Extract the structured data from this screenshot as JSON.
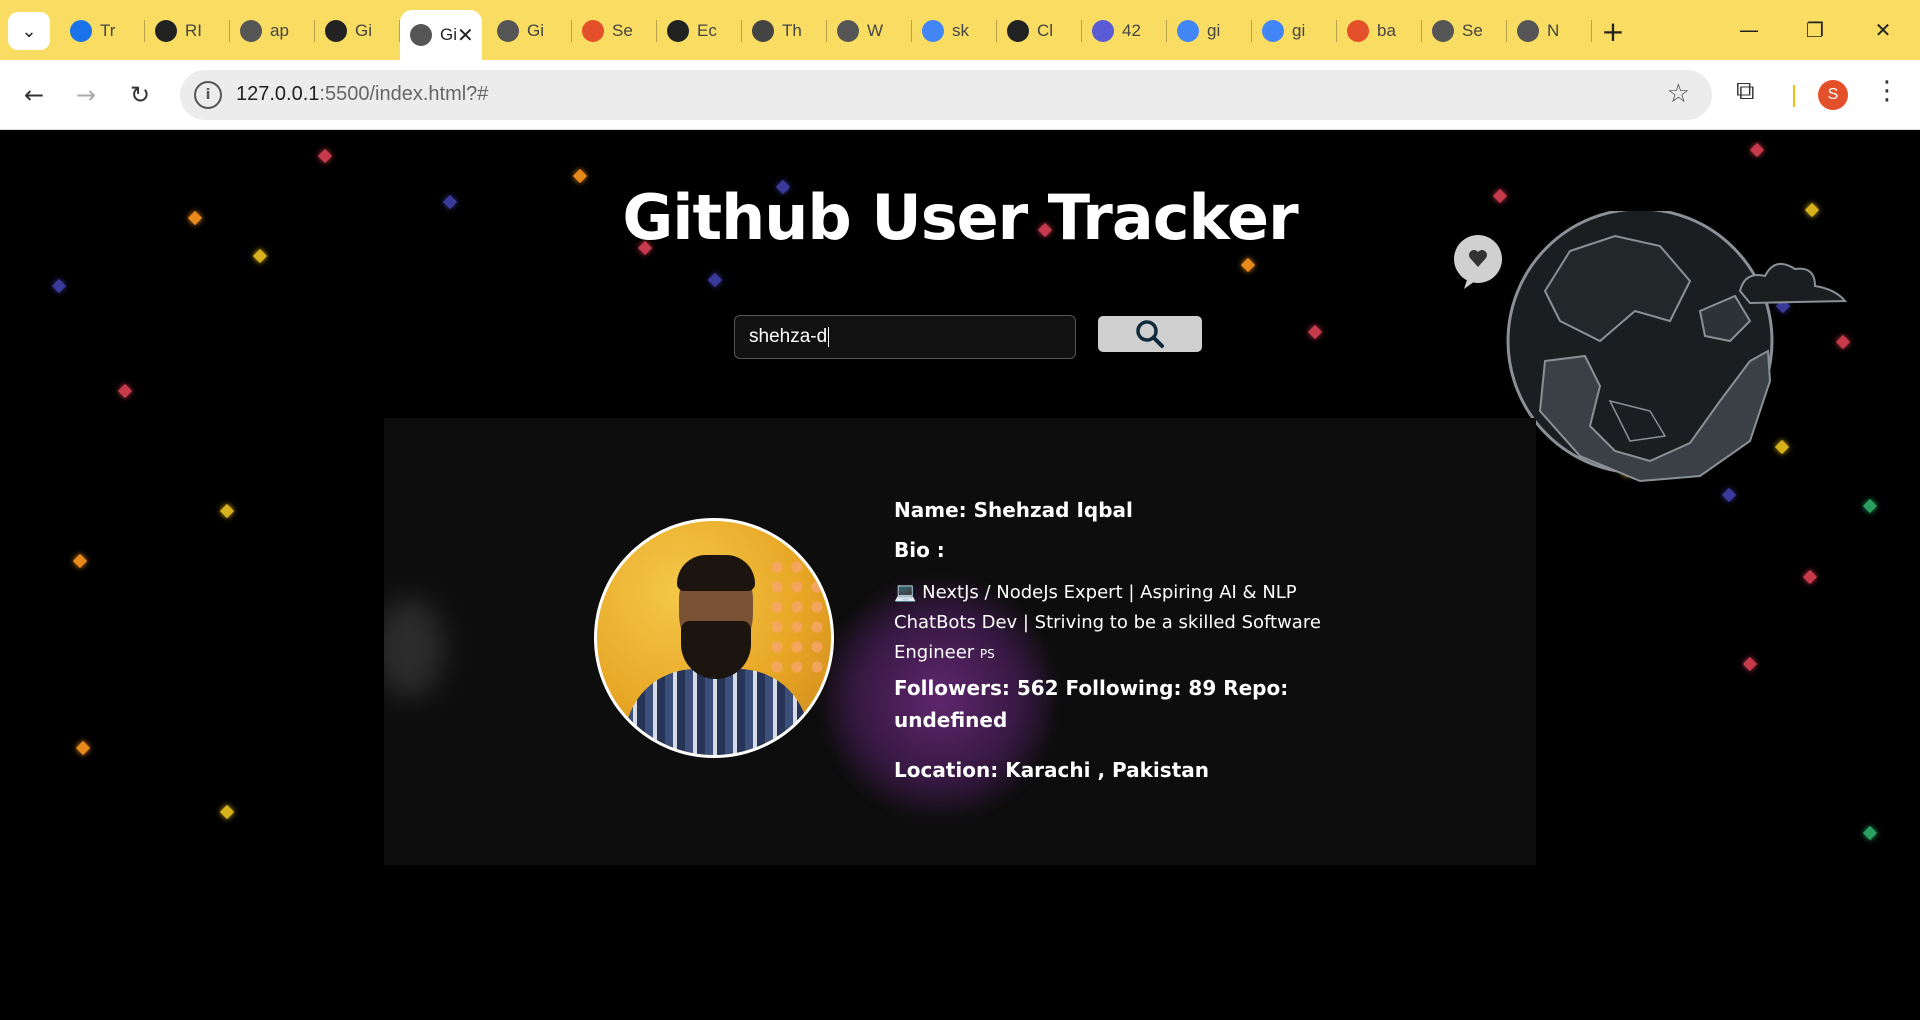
{
  "browser": {
    "tabs": [
      {
        "label": "Tr",
        "icon": "chrome-icon",
        "color": "#1a73e8"
      },
      {
        "label": "RI",
        "icon": "github-icon",
        "color": "#222222"
      },
      {
        "label": "ap",
        "icon": "globe-icon",
        "color": "#555555"
      },
      {
        "label": "Gi",
        "icon": "github-icon",
        "color": "#222222"
      },
      {
        "label": "Gi",
        "icon": "globe-icon",
        "color": "#555555",
        "active": true
      },
      {
        "label": "Gi",
        "icon": "globe-icon",
        "color": "#555555"
      },
      {
        "label": "Se",
        "icon": "colorful-icon",
        "color": "#e4502a"
      },
      {
        "label": "Ec",
        "icon": "github-icon",
        "color": "#222222"
      },
      {
        "label": "Th",
        "icon": "css-icon",
        "color": "#444444"
      },
      {
        "label": "W",
        "icon": "globe-icon",
        "color": "#555555"
      },
      {
        "label": "sk",
        "icon": "google-icon",
        "color": "#4285f4"
      },
      {
        "label": "Cl",
        "icon": "openai-icon",
        "color": "#222222"
      },
      {
        "label": "42",
        "icon": "code-icon",
        "color": "#5b5bd6"
      },
      {
        "label": "gi",
        "icon": "google-icon",
        "color": "#4285f4"
      },
      {
        "label": "gi",
        "icon": "google-icon",
        "color": "#4285f4"
      },
      {
        "label": "ba",
        "icon": "asterisk-icon",
        "color": "#e4502a"
      },
      {
        "label": "Se",
        "icon": "globe-icon",
        "color": "#555555"
      },
      {
        "label": "N",
        "icon": "chrome-icon",
        "color": "#555555"
      }
    ],
    "url_host": "127.0.0.1",
    "url_rest": ":5500/index.html?#",
    "profile_initial": "S"
  },
  "page": {
    "title": "Github User Tracker",
    "search": {
      "value": "shehza-d"
    },
    "user": {
      "name_line": "Name: Shehzad Iqbal",
      "bio_label": "Bio :",
      "bio_text": "💻 NextJs / NodeJs Expert | Aspiring AI & NLP ChatBots Dev | Striving to be a skilled Software Engineer",
      "bio_suffix": "PS",
      "stats_line": "Followers: 562 Following: 89 Repo: undefined",
      "location_line": "Location: Karachi , Pakistan"
    }
  },
  "colors": {
    "tabstrip": "#f9dd63",
    "page_bg": "#000000",
    "card_bg": "#0d0d0d"
  }
}
